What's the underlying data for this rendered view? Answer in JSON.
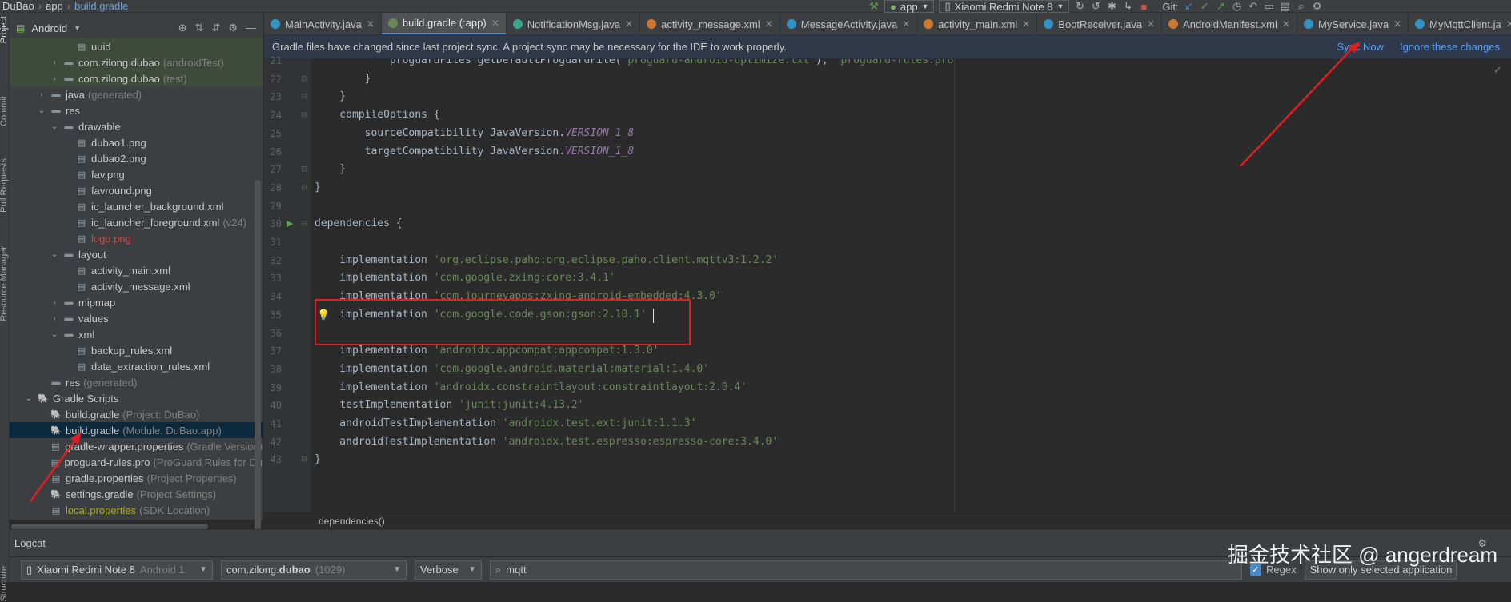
{
  "breadcrumb": {
    "project": "DuBao",
    "module": "app",
    "file": "build.gradle"
  },
  "toolbar": {
    "run_config": "app",
    "device": "Xiaomi Redmi Note 8",
    "git_label": "Git:"
  },
  "side_tool_windows": {
    "project": "Project",
    "commit": "Commit",
    "pull_requests": "Pull Requests",
    "resource_manager": "Resource Manager",
    "structure": "Structure"
  },
  "project_panel": {
    "view_mode": "Android"
  },
  "tree": [
    {
      "indent": 2,
      "arrow": "",
      "icon": "file",
      "label": "uuid",
      "extra": "",
      "style": "hl"
    },
    {
      "indent": 1,
      "arrow": "›",
      "icon": "folder",
      "label": "com.zilong.dubao",
      "extra": "(androidTest)",
      "style": "hl"
    },
    {
      "indent": 1,
      "arrow": "›",
      "icon": "folder",
      "label": "com.zilong.dubao",
      "extra": "(test)",
      "style": "hl"
    },
    {
      "indent": 0,
      "arrow": "›",
      "icon": "folder",
      "label": "java",
      "extra": "(generated)",
      "style": ""
    },
    {
      "indent": 0,
      "arrow": "⌄",
      "icon": "folder",
      "label": "res",
      "extra": "",
      "style": ""
    },
    {
      "indent": 1,
      "arrow": "⌄",
      "icon": "folder",
      "label": "drawable",
      "extra": "",
      "style": ""
    },
    {
      "indent": 2,
      "arrow": "",
      "icon": "file",
      "label": "dubao1.png",
      "extra": "",
      "style": ""
    },
    {
      "indent": 2,
      "arrow": "",
      "icon": "file",
      "label": "dubao2.png",
      "extra": "",
      "style": ""
    },
    {
      "indent": 2,
      "arrow": "",
      "icon": "file",
      "label": "fav.png",
      "extra": "",
      "style": ""
    },
    {
      "indent": 2,
      "arrow": "",
      "icon": "file",
      "label": "favround.png",
      "extra": "",
      "style": ""
    },
    {
      "indent": 2,
      "arrow": "",
      "icon": "file",
      "label": "ic_launcher_background.xml",
      "extra": "",
      "style": ""
    },
    {
      "indent": 2,
      "arrow": "",
      "icon": "file",
      "label": "ic_launcher_foreground.xml",
      "extra": "(v24)",
      "style": ""
    },
    {
      "indent": 2,
      "arrow": "",
      "icon": "file",
      "label": "logo.png",
      "extra": "",
      "style": "red"
    },
    {
      "indent": 1,
      "arrow": "⌄",
      "icon": "folder",
      "label": "layout",
      "extra": "",
      "style": ""
    },
    {
      "indent": 2,
      "arrow": "",
      "icon": "file",
      "label": "activity_main.xml",
      "extra": "",
      "style": ""
    },
    {
      "indent": 2,
      "arrow": "",
      "icon": "file",
      "label": "activity_message.xml",
      "extra": "",
      "style": ""
    },
    {
      "indent": 1,
      "arrow": "›",
      "icon": "folder",
      "label": "mipmap",
      "extra": "",
      "style": ""
    },
    {
      "indent": 1,
      "arrow": "›",
      "icon": "folder",
      "label": "values",
      "extra": "",
      "style": ""
    },
    {
      "indent": 1,
      "arrow": "⌄",
      "icon": "folder",
      "label": "xml",
      "extra": "",
      "style": ""
    },
    {
      "indent": 2,
      "arrow": "",
      "icon": "file",
      "label": "backup_rules.xml",
      "extra": "",
      "style": ""
    },
    {
      "indent": 2,
      "arrow": "",
      "icon": "file",
      "label": "data_extraction_rules.xml",
      "extra": "",
      "style": ""
    },
    {
      "indent": 0,
      "arrow": "",
      "icon": "folder",
      "label": "res",
      "extra": "(generated)",
      "style": ""
    },
    {
      "indent": -1,
      "arrow": "⌄",
      "icon": "gradle",
      "label": "Gradle Scripts",
      "extra": "",
      "style": ""
    },
    {
      "indent": 0,
      "arrow": "",
      "icon": "gradle",
      "label": "build.gradle",
      "extra": "(Project: DuBao)",
      "style": ""
    },
    {
      "indent": 0,
      "arrow": "",
      "icon": "gradle",
      "label": "build.gradle",
      "extra": "(Module: DuBao.app)",
      "style": "sel"
    },
    {
      "indent": 0,
      "arrow": "",
      "icon": "file",
      "label": "gradle-wrapper.properties",
      "extra": "(Gradle Version)",
      "style": ""
    },
    {
      "indent": 0,
      "arrow": "",
      "icon": "file",
      "label": "proguard-rules.pro",
      "extra": "(ProGuard Rules for Du",
      "style": ""
    },
    {
      "indent": 0,
      "arrow": "",
      "icon": "file",
      "label": "gradle.properties",
      "extra": "(Project Properties)",
      "style": ""
    },
    {
      "indent": 0,
      "arrow": "",
      "icon": "gradle",
      "label": "settings.gradle",
      "extra": "(Project Settings)",
      "style": ""
    },
    {
      "indent": 0,
      "arrow": "",
      "icon": "file",
      "label": "local.properties",
      "extra": "(SDK Location)",
      "style": "olive"
    }
  ],
  "tabs": [
    {
      "label": "MainActivity.java",
      "color": "#3592c4",
      "active": false
    },
    {
      "label": "build.gradle (:app)",
      "color": "#6a8759",
      "active": true
    },
    {
      "label": "NotificationMsg.java",
      "color": "#3aa68a",
      "active": false
    },
    {
      "label": "activity_message.xml",
      "color": "#cc7832",
      "active": false
    },
    {
      "label": "MessageActivity.java",
      "color": "#3592c4",
      "active": false
    },
    {
      "label": "activity_main.xml",
      "color": "#cc7832",
      "active": false
    },
    {
      "label": "BootReceiver.java",
      "color": "#3592c4",
      "active": false
    },
    {
      "label": "AndroidManifest.xml",
      "color": "#cc7832",
      "active": false
    },
    {
      "label": "MyService.java",
      "color": "#3592c4",
      "active": false
    },
    {
      "label": "MyMqttClient.ja",
      "color": "#3592c4",
      "active": false
    }
  ],
  "notification": {
    "message": "Gradle files have changed since last project sync. A project sync may be necessary for the IDE to work properly.",
    "sync_now": "Sync Now",
    "ignore": "Ignore these changes"
  },
  "editor": {
    "lines": [
      {
        "num": "21",
        "segs": [
          {
            "t": "            proguardFiles getDefaultProguardFile(",
            "c": ""
          },
          {
            "t": "'proguard-android-optimize.txt'",
            "c": "str"
          },
          {
            "t": "), ",
            "c": ""
          },
          {
            "t": "'proguard-rules.pro'",
            "c": "str"
          }
        ]
      },
      {
        "num": "22",
        "segs": [
          {
            "t": "        }",
            "c": ""
          }
        ]
      },
      {
        "num": "23",
        "segs": [
          {
            "t": "    }",
            "c": ""
          }
        ]
      },
      {
        "num": "24",
        "segs": [
          {
            "t": "    compileOptions {",
            "c": ""
          }
        ]
      },
      {
        "num": "25",
        "segs": [
          {
            "t": "        sourceCompatibility JavaVersion.",
            "c": ""
          },
          {
            "t": "VERSION_1_8",
            "c": "ital"
          }
        ]
      },
      {
        "num": "26",
        "segs": [
          {
            "t": "        targetCompatibility JavaVersion.",
            "c": ""
          },
          {
            "t": "VERSION_1_8",
            "c": "ital"
          }
        ]
      },
      {
        "num": "27",
        "segs": [
          {
            "t": "    }",
            "c": ""
          }
        ]
      },
      {
        "num": "28",
        "segs": [
          {
            "t": "}",
            "c": ""
          }
        ]
      },
      {
        "num": "29",
        "segs": []
      },
      {
        "num": "30",
        "segs": [
          {
            "t": "dependencies {",
            "c": ""
          }
        ]
      },
      {
        "num": "31",
        "segs": []
      },
      {
        "num": "32",
        "segs": [
          {
            "t": "    implementation ",
            "c": ""
          },
          {
            "t": "'org.eclipse.paho:org.eclipse.paho.client.mqttv3:1.2.2'",
            "c": "str"
          }
        ]
      },
      {
        "num": "33",
        "segs": [
          {
            "t": "    implementation ",
            "c": ""
          },
          {
            "t": "'com.google.zxing:core:3.4.1'",
            "c": "str"
          }
        ]
      },
      {
        "num": "34",
        "segs": [
          {
            "t": "    implementation ",
            "c": ""
          },
          {
            "t": "'com.journeyapps:zxing-android-embedded:4.3.0'",
            "c": "str"
          }
        ]
      },
      {
        "num": "35",
        "segs": [
          {
            "t": "    implementation ",
            "c": ""
          },
          {
            "t": "'com.google.code.gson:gson:2.10.1'",
            "c": "str"
          }
        ]
      },
      {
        "num": "36",
        "segs": []
      },
      {
        "num": "37",
        "segs": [
          {
            "t": "    implementation ",
            "c": ""
          },
          {
            "t": "'androidx.appcompat:appcompat:1.3.0'",
            "c": "str"
          }
        ]
      },
      {
        "num": "38",
        "segs": [
          {
            "t": "    implementation ",
            "c": ""
          },
          {
            "t": "'com.google.android.material:material:1.4.0'",
            "c": "str"
          }
        ]
      },
      {
        "num": "39",
        "segs": [
          {
            "t": "    implementation ",
            "c": ""
          },
          {
            "t": "'androidx.constraintlayout:constraintlayout:2.0.4'",
            "c": "str"
          }
        ]
      },
      {
        "num": "40",
        "segs": [
          {
            "t": "    testImplementation ",
            "c": ""
          },
          {
            "t": "'junit:junit:4.13.2'",
            "c": "str"
          }
        ]
      },
      {
        "num": "41",
        "segs": [
          {
            "t": "    androidTestImplementation ",
            "c": ""
          },
          {
            "t": "'androidx.test.ext:junit:1.1.3'",
            "c": "str"
          }
        ]
      },
      {
        "num": "42",
        "segs": [
          {
            "t": "    androidTestImplementation ",
            "c": ""
          },
          {
            "t": "'androidx.test.espresso:espresso-core:3.4.0'",
            "c": "str"
          }
        ]
      },
      {
        "num": "43",
        "segs": [
          {
            "t": "}",
            "c": ""
          }
        ]
      }
    ],
    "structure_breadcrumb": "dependencies()"
  },
  "logcat": {
    "title": "Logcat",
    "device": "Xiaomi Redmi Note 8",
    "device_extra": "Android 1",
    "process": "com.zilong.",
    "process_bold": "dubao",
    "process_pid": "(1029)",
    "level": "Verbose",
    "search": "mqtt",
    "regex_label": "Regex",
    "regex_checked": true,
    "filter": "Show only selected application"
  },
  "watermark": "掘金技术社区 @ angerdream",
  "colors": {
    "accent": "#4a88c7",
    "link": "#589df6",
    "annotation": "#e02020"
  }
}
